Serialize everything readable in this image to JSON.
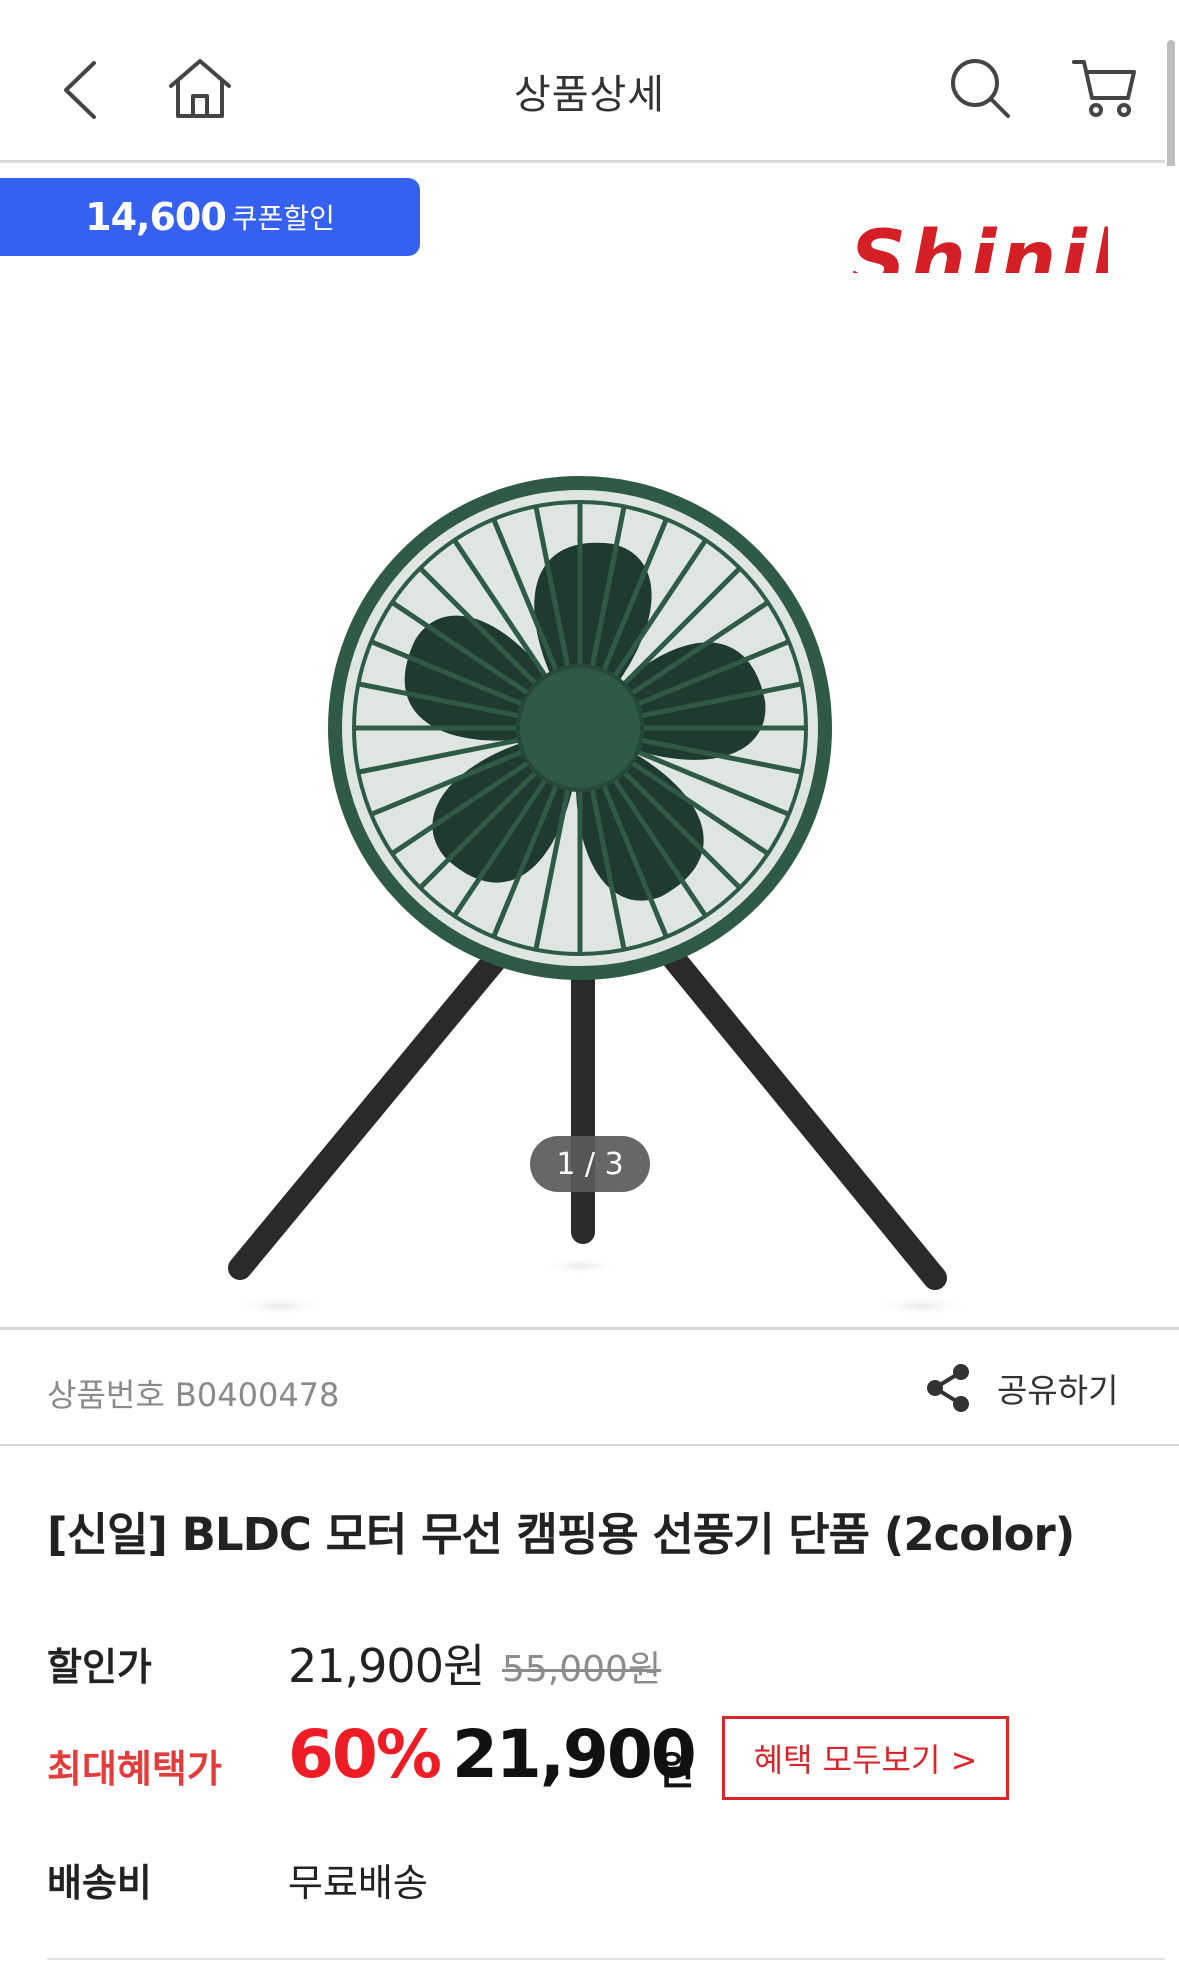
{
  "header": {
    "title": "상품상세",
    "icons": [
      "chevron-left-icon",
      "home-icon",
      "search-icon",
      "cart-icon"
    ]
  },
  "gallery": {
    "coupon_amount": "14,600",
    "coupon_label": "쿠폰할인",
    "brand_logo_text": "Shinil",
    "pager": "1 / 3",
    "product_color": "#2f5a46"
  },
  "meta": {
    "product_code": "상품번호 B0400478",
    "share_label": "공유하기"
  },
  "product": {
    "title": "[신일] BLDC 모터 무선 캠핑용 선풍기 단품 (2color)"
  },
  "pricing": {
    "sale_label": "할인가",
    "sale_price": "21,900원",
    "original_price": "55,000원",
    "best_label": "최대혜택가",
    "discount": "60%",
    "best_price": "21,900",
    "best_unit": "원",
    "benefit_button": "혜택 모두보기 >",
    "shipping_label": "배송비",
    "shipping_value": "무료배송"
  },
  "colors": {
    "coupon_blue": "#3560f0",
    "discount_red": "#ee1c25",
    "benefit_red": "#d9262b"
  }
}
